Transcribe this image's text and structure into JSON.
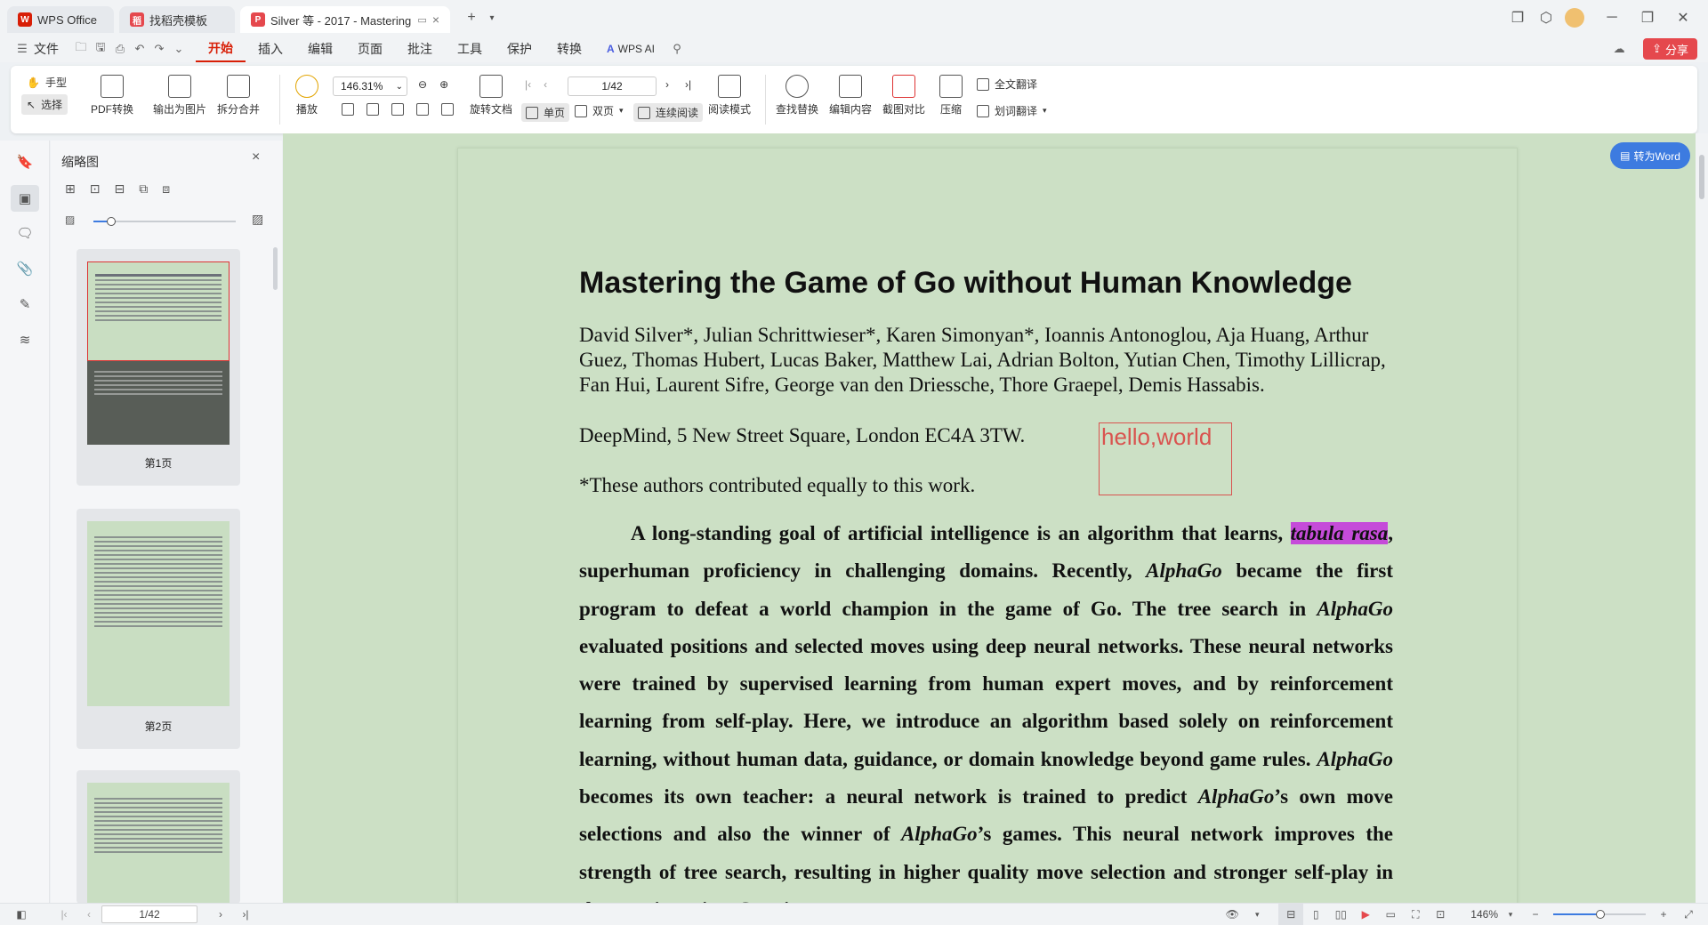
{
  "titlebar": {
    "tabs": [
      {
        "label": "WPS Office"
      },
      {
        "label": "找稻壳模板"
      },
      {
        "label": "Silver 等 - 2017 - Mastering"
      }
    ],
    "new_tab": "+"
  },
  "menubar": {
    "file": "文件",
    "tabs": [
      "开始",
      "插入",
      "编辑",
      "页面",
      "批注",
      "工具",
      "保护",
      "转换"
    ],
    "wps_ai": "WPS AI",
    "share": "分享"
  },
  "ribbon": {
    "hand": "手型",
    "select": "选择",
    "pdf_convert": "PDF转换",
    "export_image": "输出为图片",
    "split_merge": "拆分合并",
    "play": "播放",
    "zoom_value": "146.31%",
    "page_value": "1/42",
    "rotate": "旋转文档",
    "single": "单页",
    "double": "双页",
    "continuous": "连续阅读",
    "read_mode": "阅读模式",
    "find_replace": "查找替换",
    "edit_content": "编辑内容",
    "crop_compare": "截图对比",
    "compress": "压缩",
    "full_translate": "全文翻译",
    "word_translate": "划词翻译"
  },
  "thumbnails": {
    "title": "缩略图",
    "pages": [
      "第1页",
      "第2页"
    ]
  },
  "document": {
    "title": "Mastering the Game of Go without Human Knowledge",
    "authors": "David Silver*, Julian Schrittwieser*, Karen Simonyan*, Ioannis Antonoglou, Aja Huang, Arthur Guez, Thomas Hubert, Lucas Baker, Matthew Lai, Adrian Bolton, Yutian Chen, Timothy Lillicrap, Fan Hui, Laurent Sifre, George van den Driessche, Thore Graepel, Demis Hassabis.",
    "affiliation": "DeepMind, 5 New Street Square, London EC4A 3TW.",
    "contribution": "*These authors contributed equally to this work.",
    "annotation": "hello,world",
    "abstract": {
      "p1": "A long-standing goal of artificial intelligence is an algorithm that learns, ",
      "hl": "tabula rasa",
      "p2": ", su­perhuman proficiency in challenging domains. Recently, ",
      "ag1": "AlphaGo",
      "p3": " became the first program to defeat a world champion in the game of Go. The tree search in ",
      "ag2": "AlphaGo",
      "p4": " evaluated posi­tions and selected moves using deep neural networks. These neural networks were trained by supervised learning from human expert moves, and by reinforcement learning from self-play. Here, we introduce an algorithm based solely on reinforcement learning, without hu­man data, guidance, or domain knowledge beyond game rules. ",
      "ag3": "AlphaGo",
      "p5": " becomes its own teacher: a neural network is trained to predict ",
      "ag4": "AlphaGo",
      "p6": "’s own move selections and also the winner of ",
      "ag5": "AlphaGo",
      "p7": "’s games. This neural network improves the strength of tree search, re­sulting in higher quality move selection and stronger self-play in the next iteration. Starting"
    },
    "convert_word": "转为Word"
  },
  "statusbar": {
    "page": "1/42",
    "zoom": "146%"
  }
}
